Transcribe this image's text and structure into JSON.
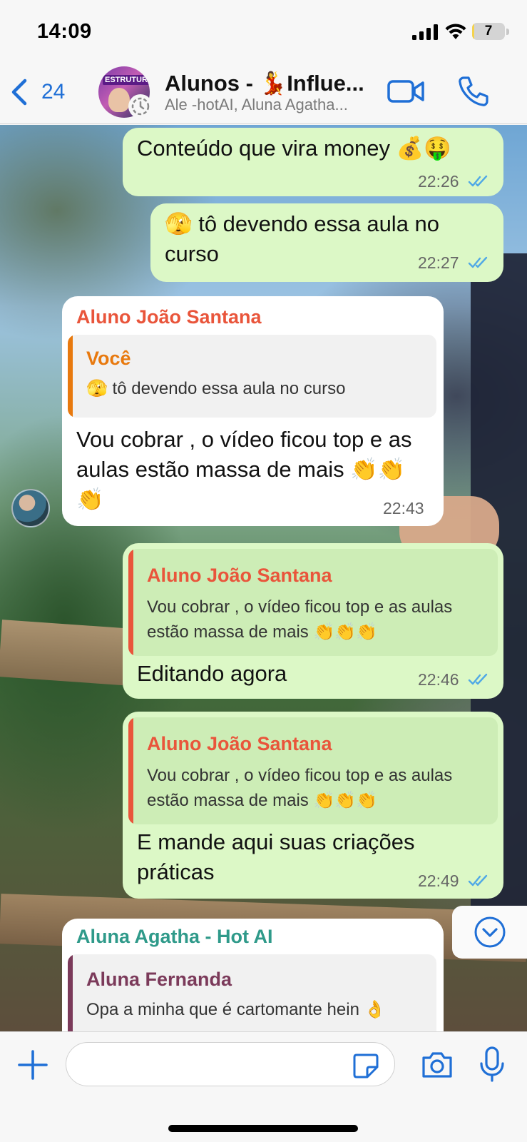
{
  "status_bar": {
    "time": "14:09",
    "battery": "7",
    "battery_level": 0.07
  },
  "header": {
    "back_count": "24",
    "title": "Alunos - 💃Influe...",
    "subtitle": "Ale -hotAI, Aluna Agatha...",
    "avatar_text": "ESTRUTURA",
    "icons": {
      "back": "chevron-left-icon",
      "video": "video-camera-icon",
      "call": "phone-icon",
      "status": "status-ring-icon"
    }
  },
  "colors": {
    "accent": "#1f6fd6",
    "outgoing": "#dcf8c6",
    "incoming": "#ffffff",
    "read_ticks": "#4fa8e6",
    "sender_joao": "#e9553b",
    "sender_agatha": "#2f9a8a",
    "quote_voce": "#e8790e",
    "quote_fernanda": "#7b3a5a"
  },
  "messages": [
    {
      "text": "Conteúdo que vira money 💰🤑",
      "time": "22:26"
    },
    {
      "text": "🫣 tô devendo essa aula no curso",
      "time": "22:27"
    },
    {
      "sender": "Aluno João Santana",
      "quote_name": "Você",
      "quote_text": "🫣 tô devendo essa aula no curso",
      "text": "Vou cobrar , o vídeo ficou top e as aulas estão massa de mais 👏👏👏",
      "time": "22:43"
    },
    {
      "quote_name": "Aluno João Santana",
      "quote_text": "Vou cobrar , o vídeo ficou top e as aulas estão massa de mais 👏👏👏",
      "text": "Editando agora",
      "time": "22:46"
    },
    {
      "quote_name": "Aluno João Santana",
      "quote_text": "Vou cobrar , o vídeo ficou top e as aulas estão massa de mais 👏👏👏",
      "text": "E mande aqui suas criações práticas",
      "time": "22:49"
    },
    {
      "sender": "Aluna Agatha - Hot AI",
      "quote_name": "Aluna Fernanda",
      "quote_text": "Opa a minha que é cartomante hein 👌"
    }
  ],
  "input_bar": {
    "icons": {
      "plus": "plus-icon",
      "sticker": "sticker-icon",
      "camera": "camera-icon",
      "mic": "microphone-icon",
      "scroll": "chevron-down-circle-icon"
    }
  }
}
